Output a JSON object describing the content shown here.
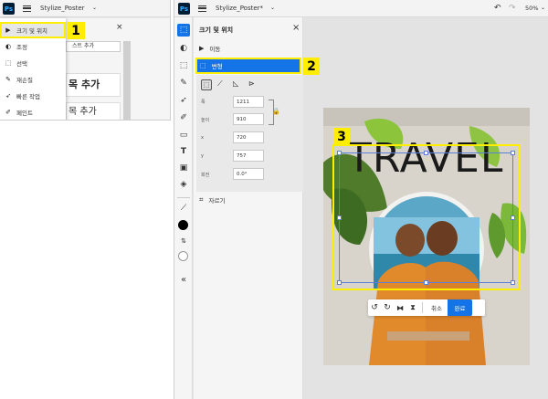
{
  "left": {
    "app_logo": "Ps",
    "file_name": "Stylize_Poster",
    "panel_close": "×",
    "menu_items": [
      {
        "label": "크기 및 위치",
        "icon": "transform-icon"
      },
      {
        "label": "조정",
        "icon": "adjust-icon"
      },
      {
        "label": "선택",
        "icon": "select-icon"
      },
      {
        "label": "재손질",
        "icon": "retouch-icon"
      },
      {
        "label": "빠른 작업",
        "icon": "quick-action-icon"
      },
      {
        "label": "페인트",
        "icon": "paint-icon"
      }
    ],
    "bg_input_text": "스트 추가",
    "bg_heading1": "목 추가",
    "bg_heading2": "목 추가"
  },
  "right": {
    "app_logo": "Ps",
    "file_name": "Stylize_Poster*",
    "zoom": "50%",
    "panel_title": "크기 및 위치",
    "panel_close": "×",
    "move_label": "이동",
    "transform_label": "변형",
    "fields": [
      {
        "label": "폭",
        "value": "1211"
      },
      {
        "label": "높이",
        "value": "910"
      },
      {
        "label": "x",
        "value": "720"
      },
      {
        "label": "y",
        "value": "757"
      },
      {
        "label": "회전",
        "value": "0.0°"
      }
    ],
    "crop_label": "자르기",
    "poster_text": "TRAVEL",
    "cancel_label": "취소",
    "done_label": "완료"
  },
  "badges": [
    "1",
    "2",
    "3"
  ],
  "colors": {
    "highlight": "#ffee00",
    "accent": "#1473e6",
    "ps_dark": "#001e36",
    "ps_blue": "#31a8ff"
  }
}
